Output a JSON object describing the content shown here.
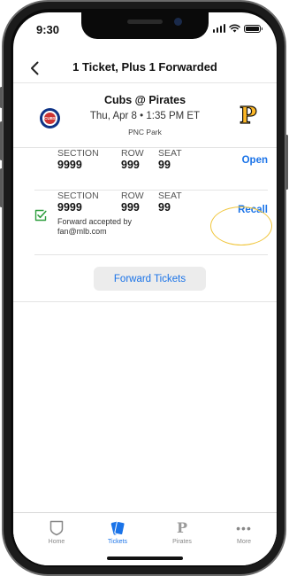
{
  "status_bar": {
    "time": "9:30"
  },
  "nav": {
    "title": "1 Ticket, Plus 1 Forwarded"
  },
  "game": {
    "matchup": "Cubs @ Pirates",
    "datetime": "Thu, Apr 8 • 1:35 PM ET",
    "venue": "PNC Park",
    "away_logo": {
      "icon": "cubs-logo-icon",
      "text": "CUBS",
      "colors": [
        "#0E3386",
        "#CC3433"
      ]
    },
    "home_logo": {
      "icon": "pirates-logo-icon",
      "text": "P",
      "color": "#FDB827"
    }
  },
  "labels": {
    "section": "SECTION",
    "row": "ROW",
    "seat": "SEAT"
  },
  "tickets": [
    {
      "section": "9999",
      "row": "999",
      "seat": "99",
      "action": "Open"
    },
    {
      "section": "9999",
      "row": "999",
      "seat": "99",
      "action": "Recall",
      "note_line1": "Forward accepted by",
      "note_line2": "fan@mlb.com"
    }
  ],
  "forward_button": "Forward Tickets",
  "tabs": [
    {
      "label": "Home",
      "icon": "home-shield-icon"
    },
    {
      "label": "Tickets",
      "icon": "tickets-icon",
      "active": true
    },
    {
      "label": "Pirates",
      "icon": "pirates-p-icon"
    },
    {
      "label": "More",
      "icon": "more-dots-icon"
    }
  ],
  "colors": {
    "accent": "#1a73e8",
    "highlight": "#f0c53a",
    "check": "#2e9e3e"
  }
}
